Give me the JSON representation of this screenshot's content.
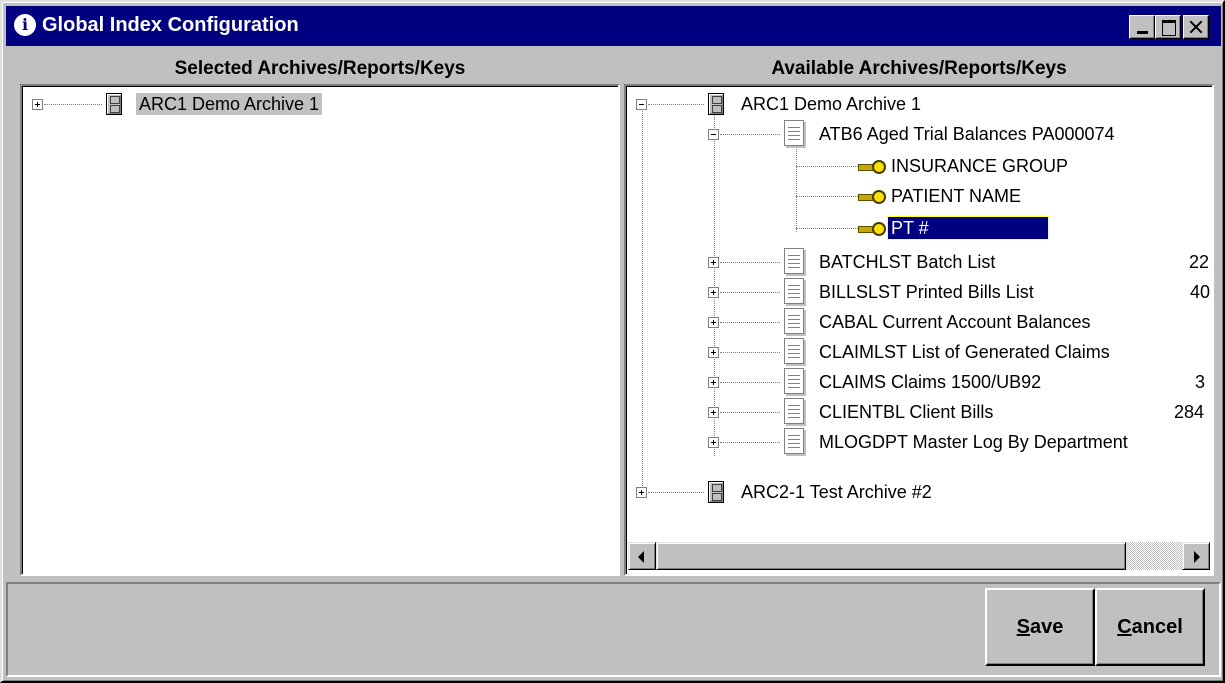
{
  "window": {
    "title": "Global Index Configuration",
    "icon": "info-icon",
    "controls": {
      "minimize": "minimize-icon",
      "maximize": "maximize-icon",
      "close": "close-icon"
    }
  },
  "left_pane": {
    "header": "Selected Archives/Reports/Keys",
    "items": [
      {
        "label": "ARC1 Demo Archive 1",
        "icon": "archive-cabinet-icon",
        "expanded": false,
        "highlighted": true
      }
    ]
  },
  "right_pane": {
    "header": "Available Archives/Reports/Keys",
    "archives": [
      {
        "label": "ARC1 Demo Archive 1",
        "icon": "archive-cabinet-icon",
        "expanded": true,
        "reports": [
          {
            "label": "ATB6 Aged Trial Balances PA000074",
            "expanded": true,
            "keys": [
              {
                "label": "INSURANCE GROUP",
                "selected": false
              },
              {
                "label": "PATIENT NAME",
                "selected": false
              },
              {
                "label": "PT #",
                "selected": true
              }
            ]
          },
          {
            "label": "BATCHLST Batch List",
            "suffix": "22"
          },
          {
            "label": "BILLSLST Printed Bills List",
            "suffix": "40"
          },
          {
            "label": "CABAL Current Account Balances",
            "suffix": ""
          },
          {
            "label": "CLAIMLST List of Generated Claims",
            "suffix": ""
          },
          {
            "label": "CLAIMS Claims 1500/UB92",
            "suffix": "3"
          },
          {
            "label": "CLIENTBL Client Bills",
            "suffix": "284"
          },
          {
            "label": "MLOGDPT Master Log By Department",
            "suffix": ""
          }
        ]
      },
      {
        "label": "ARC2-1 Test Archive #2",
        "icon": "archive-cabinet-icon",
        "expanded": false
      }
    ]
  },
  "buttons": {
    "save": {
      "mnemonic": "S",
      "rest": "ave"
    },
    "cancel": {
      "mnemonic": "C",
      "rest": "ancel"
    }
  },
  "colors": {
    "titlebar": "#000080",
    "face": "#c0c0c0",
    "selection": "#000080"
  }
}
